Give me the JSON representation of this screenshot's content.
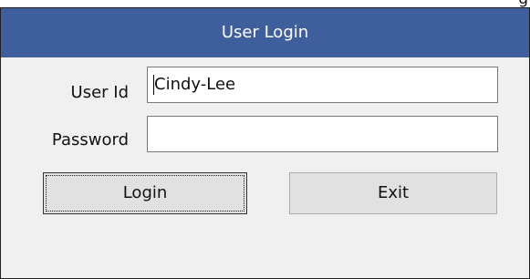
{
  "top_strip": {
    "partial_text": "g"
  },
  "window": {
    "title": "User Login",
    "user_id": {
      "label": "User Id",
      "value": "Cindy-Lee"
    },
    "password": {
      "label": "Password",
      "value": ""
    },
    "buttons": {
      "login": "Login",
      "exit": "Exit"
    }
  },
  "colors": {
    "title_bar": "#3f5f9c",
    "window_bg": "#f0f0f0",
    "button_bg": "#e1e1e1"
  }
}
